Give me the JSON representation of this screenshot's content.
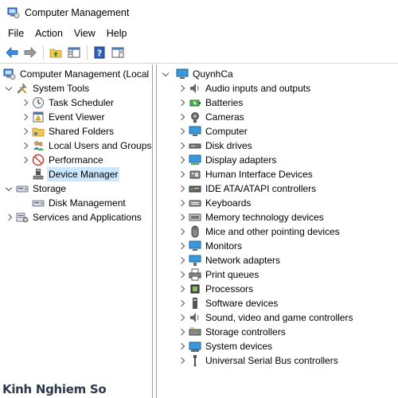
{
  "window": {
    "title": "Computer Management"
  },
  "menu": [
    "File",
    "Action",
    "View",
    "Help"
  ],
  "toolbar": {
    "buttons": [
      "back-arrow-icon",
      "forward-arrow-icon",
      "up-folder-icon",
      "show-hide-console-tree-icon",
      "help-icon",
      "show-action-pane-icon"
    ]
  },
  "tree": {
    "root": "Computer Management (Local",
    "system_tools": "System Tools",
    "task_scheduler": "Task Scheduler",
    "event_viewer": "Event Viewer",
    "shared_folders": "Shared Folders",
    "local_users": "Local Users and Groups",
    "performance": "Performance",
    "device_manager": "Device Manager",
    "storage": "Storage",
    "disk_management": "Disk Management",
    "services": "Services and Applications"
  },
  "devices": {
    "computer_name": "QuynhCa",
    "items": [
      "Audio inputs and outputs",
      "Batteries",
      "Cameras",
      "Computer",
      "Disk drives",
      "Display adapters",
      "Human Interface Devices",
      "IDE ATA/ATAPI controllers",
      "Keyboards",
      "Memory technology devices",
      "Mice and other pointing devices",
      "Monitors",
      "Network adapters",
      "Print queues",
      "Processors",
      "Software devices",
      "Sound, video and game controllers",
      "Storage controllers",
      "System devices",
      "Universal Serial Bus controllers"
    ]
  },
  "watermark": "Kinh Nghiem So",
  "colors": {
    "selection": "#cce8ff",
    "accent": "#1e6fd9"
  }
}
